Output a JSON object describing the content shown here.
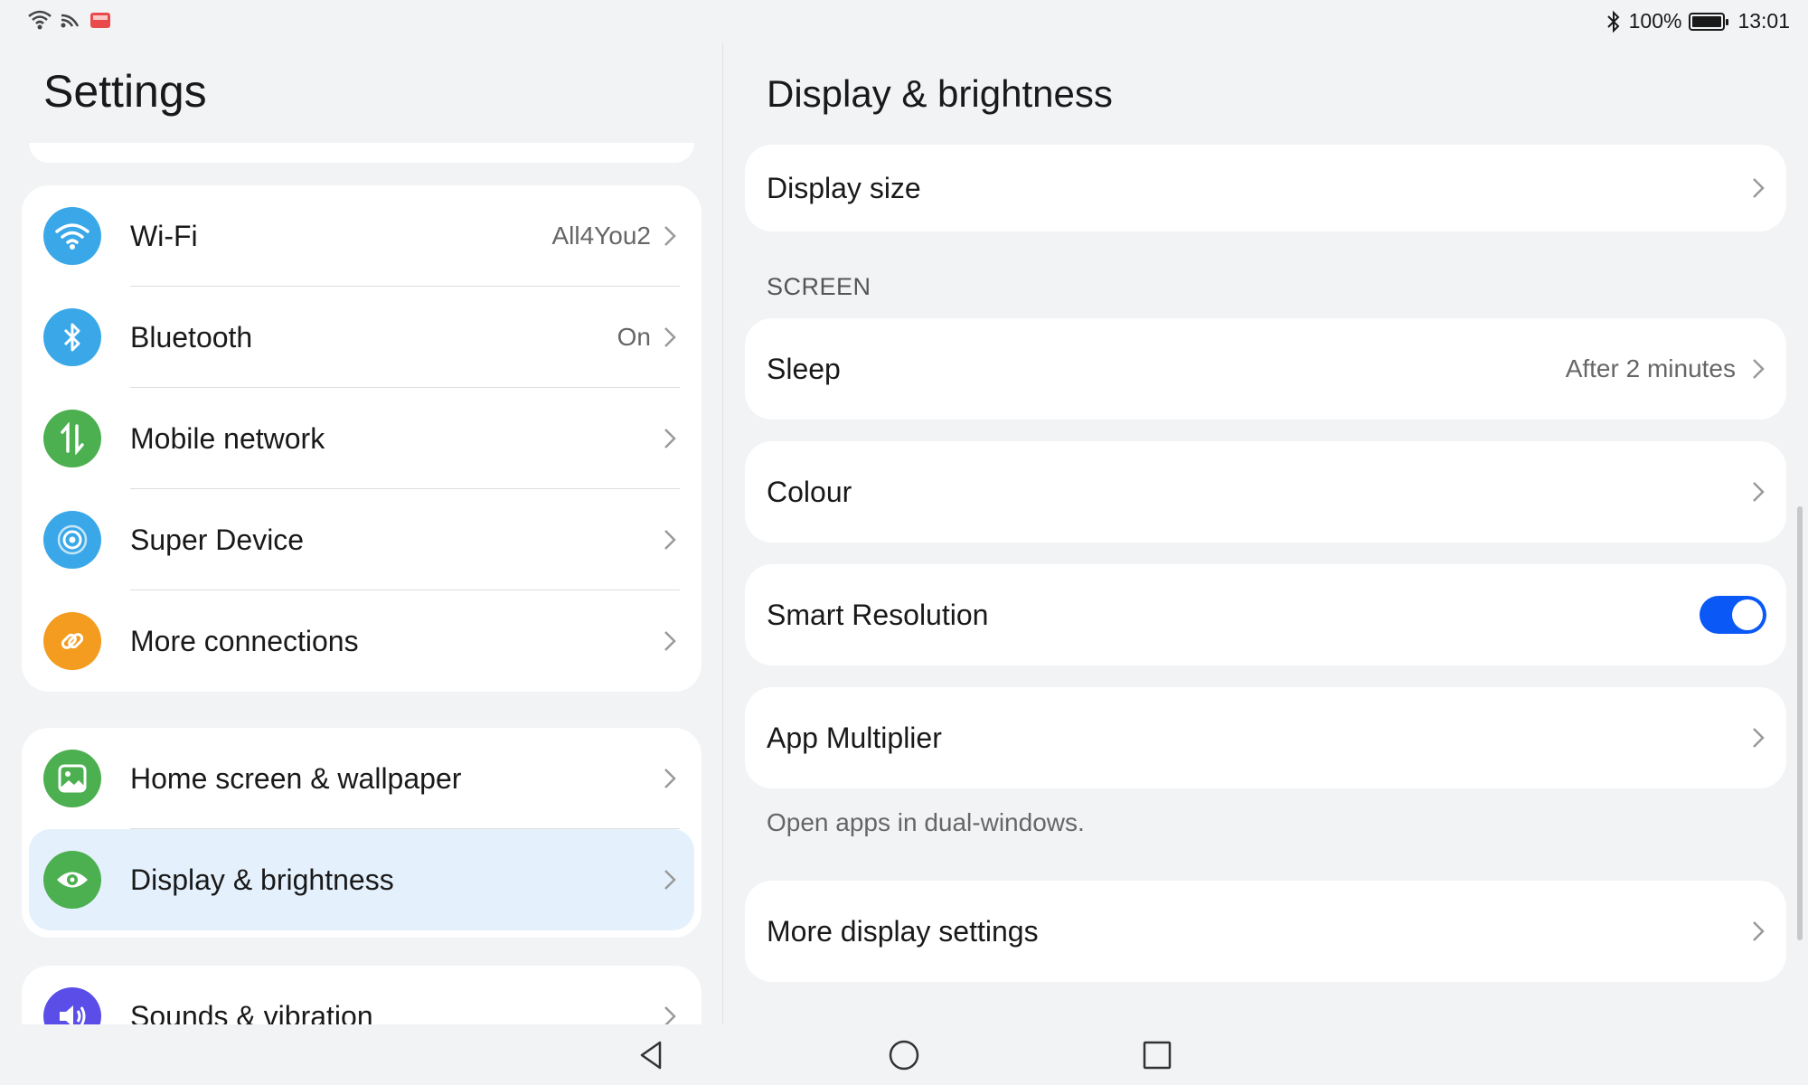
{
  "status_bar": {
    "battery": "100%",
    "time": "13:01"
  },
  "left": {
    "title": "Settings",
    "group1": [
      {
        "label": "Wi-Fi",
        "value": "All4You2",
        "icon": "wifi-icon",
        "color": "#3aa8e8"
      },
      {
        "label": "Bluetooth",
        "value": "On",
        "icon": "bluetooth-icon",
        "color": "#3aa8e8"
      },
      {
        "label": "Mobile network",
        "value": "",
        "icon": "mobile-data-icon",
        "color": "#4caf50"
      },
      {
        "label": "Super Device",
        "value": "",
        "icon": "super-device-icon",
        "color": "#3aa8e8"
      },
      {
        "label": "More connections",
        "value": "",
        "icon": "link-icon",
        "color": "#f39c1f"
      }
    ],
    "group2": [
      {
        "label": "Home screen & wallpaper",
        "icon": "image-icon",
        "color": "#4caf50"
      },
      {
        "label": "Display & brightness",
        "icon": "eye-icon",
        "color": "#4caf50"
      }
    ],
    "group3": [
      {
        "label": "Sounds & vibration",
        "icon": "speaker-icon",
        "color": "#5b4ee8"
      }
    ]
  },
  "right": {
    "title": "Display & brightness",
    "display_size": "Display size",
    "section_screen": "SCREEN",
    "sleep": {
      "label": "Sleep",
      "value": "After 2 minutes"
    },
    "colour": "Colour",
    "smart_resolution": {
      "label": "Smart Resolution",
      "enabled": true
    },
    "app_multiplier": "App Multiplier",
    "app_multiplier_note": "Open apps in dual-windows.",
    "more_display": "More display settings"
  }
}
